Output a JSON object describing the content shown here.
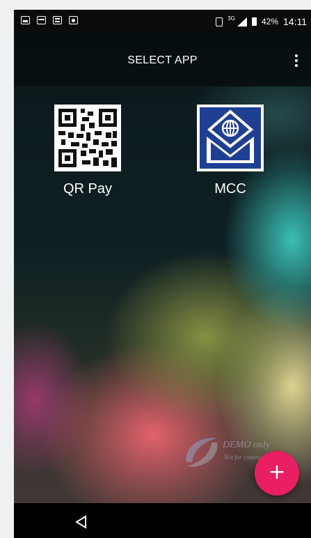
{
  "statusbar": {
    "left_icons": [
      "gallery-icon",
      "card-icon",
      "document-icon",
      "shopping-icon"
    ],
    "network": "3G",
    "battery": "42%",
    "time": "14:11"
  },
  "appbar": {
    "title": "SELECT APP",
    "menu_icon": "more-vert-icon"
  },
  "apps": [
    {
      "label": "QR Pay",
      "icon": "qr-code-icon"
    },
    {
      "label": "MCC",
      "icon": "mcc-envelope-icon"
    }
  ],
  "watermark": {
    "text": "DEMO only",
    "subtext": "Not for commercial use"
  },
  "fab": {
    "label": "+"
  },
  "colors": {
    "fab": "#e91e63",
    "mcc_blue": "#1f3f93",
    "appbar": "#0a0f10"
  }
}
